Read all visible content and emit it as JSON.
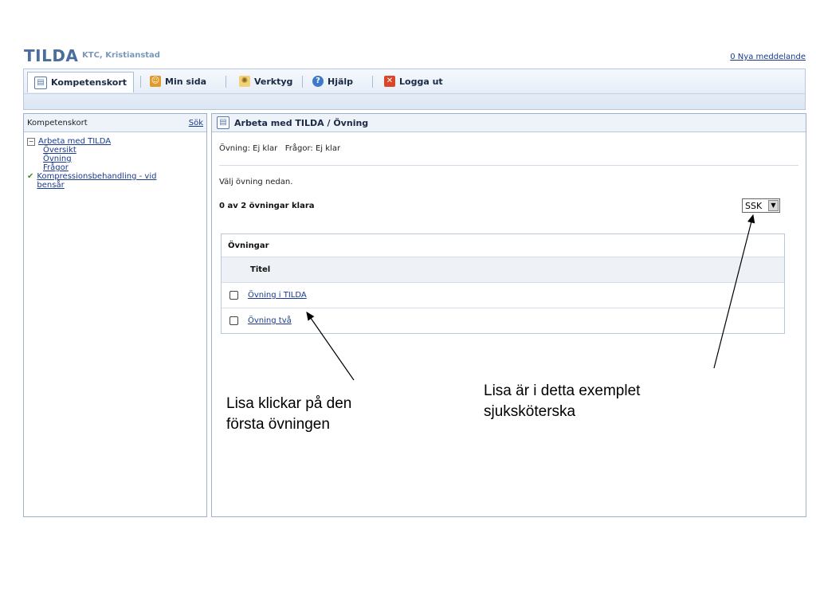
{
  "header": {
    "logo": "TILDA",
    "org": "KTC, Kristianstad",
    "messages_link": "0 Nya meddelande"
  },
  "nav": {
    "tabs": [
      {
        "label": "Kompetenskort",
        "icon": "card-icon",
        "active": true
      },
      {
        "label": "Min sida",
        "icon": "user-icon"
      },
      {
        "label": "Verktyg",
        "icon": "gear-icon"
      },
      {
        "label": "Hjälp",
        "icon": "help-icon"
      },
      {
        "label": "Logga ut",
        "icon": "logout-icon"
      }
    ]
  },
  "sidebar": {
    "title": "Kompetenskort",
    "search_link": "Sök",
    "tree": {
      "section1": {
        "label": "Arbeta med TILDA",
        "children": [
          "Översikt",
          "Övning",
          "Frågor"
        ]
      },
      "section2": {
        "label_line1": "Kompressionsbehandling - vid",
        "label_line2": "bensår"
      }
    }
  },
  "main": {
    "header": "Arbeta med TILDA / Övning",
    "status": "Övning: Ej klar   Frågor: Ej klar",
    "instruction": "Välj övning nedan.",
    "count": "0 av 2 övningar klara",
    "role_select": "SSK",
    "table": {
      "caption": "Övningar",
      "column": "Titel",
      "rows": [
        "Övning i TILDA",
        "Övning två"
      ]
    }
  },
  "annotations": {
    "left_line1": "Lisa klickar på den",
    "left_line2": "första övningen",
    "right_line1": "Lisa är i detta exemplet",
    "right_line2": "sjuksköterska"
  }
}
